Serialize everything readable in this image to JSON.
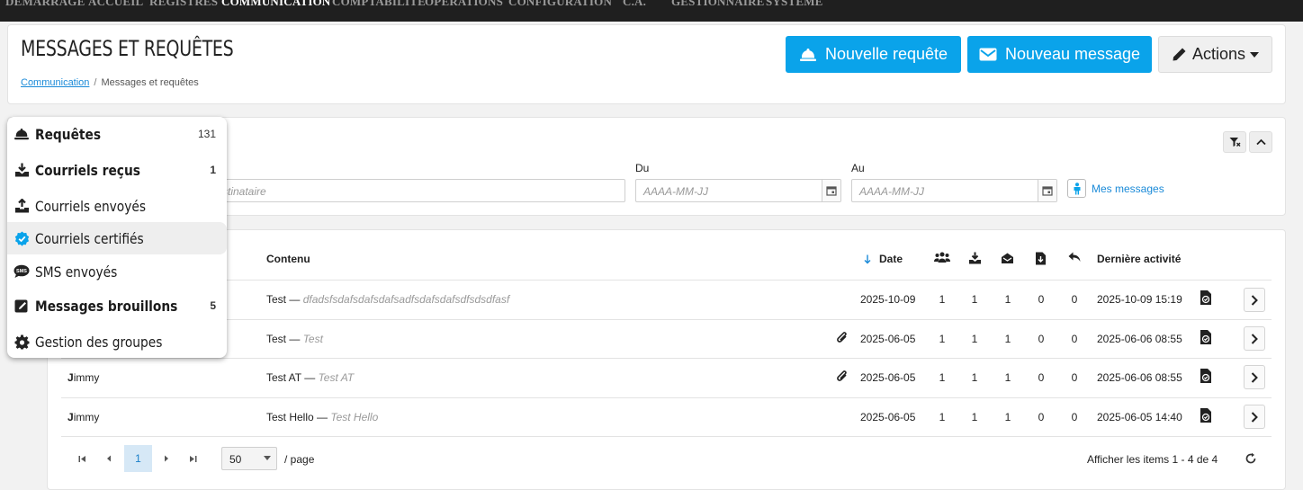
{
  "nav": {
    "items": [
      "DEMARRAGE",
      "ACCUEIL",
      "REGISTRES",
      "COMMUNICATION",
      "COMPTABILITE",
      "OPERATIONS",
      "CONFIGURATION",
      "C.A.",
      "GESTIONNAIRE",
      "SYSTEME"
    ],
    "active": "COMMUNICATION"
  },
  "header": {
    "title": "MESSAGES ET REQUÊTES",
    "breadcrumb": {
      "link": "Communication",
      "separator": "/",
      "current": "Messages et requêtes"
    },
    "buttons": {
      "new_request": "Nouvelle requête",
      "new_message": "Nouveau message",
      "actions": "Actions"
    }
  },
  "filters": {
    "recipient_placeholder_fragment": "stinataire",
    "from_label": "Du",
    "to_label": "Au",
    "date_placeholder": "AAAA-MM-JJ",
    "my_messages": "Mes messages"
  },
  "menu": {
    "items": [
      {
        "label": "Requêtes",
        "count": "131",
        "bold": true,
        "count_bold": false,
        "icon": "bell-icon"
      },
      {
        "label": "Courriels reçus",
        "count": "1",
        "bold": true,
        "count_bold": true,
        "icon": "download-icon"
      },
      {
        "label": "Courriels envoyés",
        "count": "",
        "bold": false,
        "count_bold": false,
        "icon": "upload-icon"
      },
      {
        "label": "Courriels certifiés",
        "count": "",
        "bold": false,
        "count_bold": false,
        "icon": "badge-check-icon"
      },
      {
        "label": "SMS envoyés",
        "count": "",
        "bold": false,
        "count_bold": false,
        "icon": "sms-icon"
      },
      {
        "label": "Messages brouillons",
        "count": "5",
        "bold": true,
        "count_bold": true,
        "icon": "edit-icon"
      },
      {
        "label": "Gestion des groupes",
        "count": "",
        "bold": false,
        "count_bold": false,
        "icon": "gear-icon"
      }
    ]
  },
  "table": {
    "headers": {
      "content": "Contenu",
      "date": "Date",
      "last_activity": "Dernière activité"
    },
    "rows": [
      {
        "sender_initial": "",
        "sender_rest": "",
        "subject": "Test",
        "preview": "dfadsfsdafsdafsdafsadfsdafsdafsdfsdsdfasf",
        "attachment": false,
        "date": "2025-10-09",
        "recipients": "1",
        "received": "1",
        "opened": "1",
        "downloaded": "0",
        "replied": "0",
        "last_activity": "2025-10-09 15:19"
      },
      {
        "sender_initial": "",
        "sender_rest": "",
        "subject": "Test",
        "preview": "Test",
        "attachment": true,
        "date": "2025-06-05",
        "recipients": "1",
        "received": "1",
        "opened": "1",
        "downloaded": "0",
        "replied": "0",
        "last_activity": "2025-06-06 08:55"
      },
      {
        "sender_initial": "J",
        "sender_rest": "immy",
        "subject": "Test AT",
        "preview": "Test AT",
        "attachment": true,
        "date": "2025-06-05",
        "recipients": "1",
        "received": "1",
        "opened": "1",
        "downloaded": "0",
        "replied": "0",
        "last_activity": "2025-06-06 08:55"
      },
      {
        "sender_initial": "J",
        "sender_rest": "immy",
        "subject": "Test Hello",
        "preview": "Test Hello",
        "attachment": false,
        "date": "2025-06-05",
        "recipients": "1",
        "received": "1",
        "opened": "1",
        "downloaded": "0",
        "replied": "0",
        "last_activity": "2025-06-05 14:40"
      }
    ]
  },
  "pager": {
    "current_page": "1",
    "per_page": "50",
    "per_page_suffix": "/ page",
    "summary": "Afficher les items 1 - 4 de 4"
  },
  "colors": {
    "accent": "#0aa3ea",
    "nav_bg": "#1f1f1f",
    "link": "#1a8ad8"
  }
}
